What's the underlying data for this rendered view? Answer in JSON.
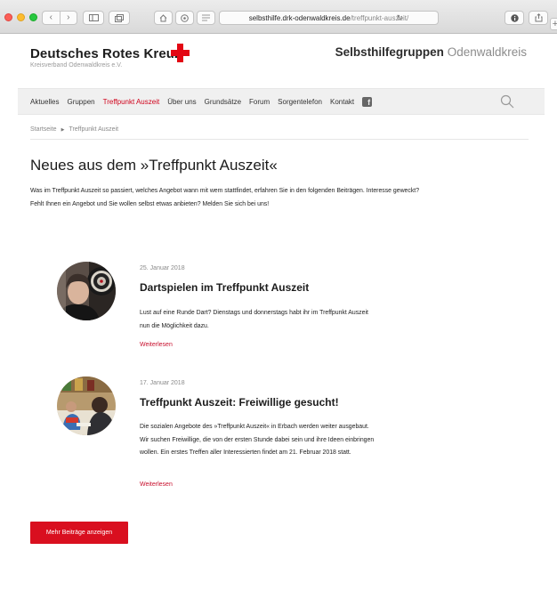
{
  "browser": {
    "url_host": "selbsthilfe.drk-odenwaldkreis.de",
    "url_path": "/treffpunkt-auszeit/",
    "back_glyph": "‹",
    "forward_glyph": "›"
  },
  "header": {
    "brand_title": "Deutsches Rotes Kreuz",
    "brand_subtitle": "Kreisverband Odenwaldkreis e.V.",
    "site_name_bold": "Selbsthilfegruppen",
    "site_name_light": "Odenwaldkreis"
  },
  "nav": {
    "items": [
      "Aktuelles",
      "Gruppen",
      "Treffpunkt Auszeit",
      "Über uns",
      "Grundsätze",
      "Forum",
      "Sorgentelefon",
      "Kontakt"
    ],
    "active_index": 2
  },
  "breadcrumb": {
    "home": "Startseite",
    "current": "Treffpunkt Auszeit"
  },
  "main": {
    "title": "Neues aus dem »Treffpunkt Auszeit«",
    "intro": "Was im Treffpunkt Auszeit so passiert, welches Angebot wann mit wem stattfindet, erfahren Sie in den folgenden Beiträgen. Interesse geweckt? Fehlt Ihnen ein Angebot und Sie wollen selbst etwas anbieten? Melden Sie sich bei uns!",
    "posts": [
      {
        "date": "25. Januar 2018",
        "title": "Dartspielen im Treffpunkt Auszeit",
        "excerpt": "Lust auf eine Runde Dart? Dienstags und donnerstags habt ihr im Treffpunkt Auszeit nun die Möglichkeit dazu.",
        "more": "Weiterlesen"
      },
      {
        "date": "17. Januar 2018",
        "title": "Treffpunkt Auszeit: Freiwillige gesucht!",
        "excerpt": "Die sozialen Angebote des »Treffpunkt Auszeit« in Erbach werden weiter ausgebaut. Wir suchen Freiwillige, die von der ersten Stunde dabei sein und ihre Ideen einbringen wollen. Ein erstes Treffen aller Interessierten findet am 21. Februar 2018 statt.",
        "more": "Weiterlesen"
      }
    ],
    "more_button": "Mehr Beiträge anzeigen"
  },
  "colors": {
    "brand_red": "#e30613",
    "link_red": "#c8102e",
    "button_red": "#d90f1f",
    "nav_bg": "#f0f0f0"
  },
  "icons": {
    "red_cross": "red-cross-logo",
    "search": "search-icon",
    "facebook": "facebook-icon",
    "breadcrumb_separator": "triangle-right-icon"
  }
}
